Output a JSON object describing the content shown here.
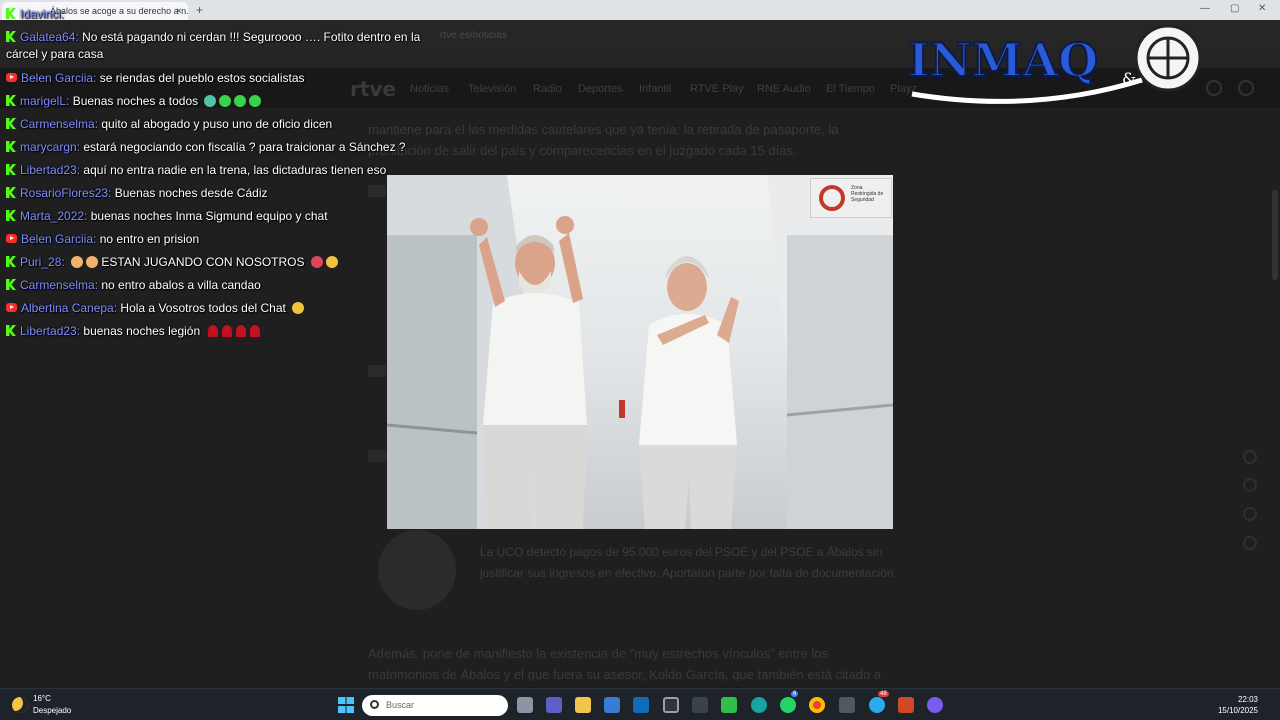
{
  "browser": {
    "tab_title": "Ábalos se acoge a su derecho a n...",
    "tab_close": "×",
    "new_tab": "+",
    "window_controls": [
      "—",
      "▢",
      "✕"
    ],
    "address": "rtve.es/noticias"
  },
  "site": {
    "logo": "rtve",
    "nav": [
      "Noticias",
      "Televisión",
      "Radio",
      "Deportes",
      "Infantil",
      "RTVE Play",
      "RNE Audio",
      "El Tiempo",
      "Playz"
    ]
  },
  "article": {
    "lines_top": [
      "mantiene para él las medidas cautelares que ya tenía: la retirada de pasaporte, la",
      "prohibición de salir del país y comparecencias en el juzgado cada 15 días."
    ],
    "quote": "La UCO detectó pagos de 95.000 euros del PSOE y del PSOE a Ábalos sin justificar sus ingresos en efectivo. Aportaron parte por falta de documentación",
    "lines_bottom": [
      "Además, pone de manifiesto la existencia de \"muy estrechos vínculos\" entre los",
      "matrimonios de Ábalos y el que fuera su asesor, Koldo García, que también está citado a"
    ],
    "photo_sign": "Zona Restringida de Seguridad"
  },
  "chat": {
    "messages": [
      {
        "platform": "kick",
        "user": "Idavinci:",
        "text": ""
      },
      {
        "platform": "kick",
        "user": "Galatea64:",
        "text": "No está pagando ni cerdan !!! Seguroooo …. Fotito dentro en la cárcel y para casa"
      },
      {
        "platform": "youtube",
        "user": "Belen Garciia:",
        "text": "se riendas del pueblo estos socialistas"
      },
      {
        "platform": "kick",
        "user": "marigelL:",
        "text": "Buenas noches a todos"
      },
      {
        "platform": "kick",
        "user": "Carmenselma:",
        "text": "quito al abogado y puso uno de oficio dicen"
      },
      {
        "platform": "kick",
        "user": "marycargn:",
        "text": "estará negociando con fiscalía ? para traicionar a Sánchez ?"
      },
      {
        "platform": "kick",
        "user": "Libertad23:",
        "text": "aquí no entra nadie en la trena, las dictaduras tienen eso"
      },
      {
        "platform": "kick",
        "user": "RosarioFlores23:",
        "text": "Buenas noches desde Cádiz"
      },
      {
        "platform": "kick",
        "user": "Marta_2022:",
        "text": "buenas noches Inma Sigmund equipo y chat"
      },
      {
        "platform": "youtube",
        "user": "Belen Garciia:",
        "text": "no entro en prision"
      },
      {
        "platform": "kick",
        "user": "Puri_28:",
        "text": "ESTAN JUGANDO CON NOSOTROS"
      },
      {
        "platform": "kick",
        "user": "Carmenselma:",
        "text": "no entro abalos a villa candao"
      },
      {
        "platform": "youtube",
        "user": "Albertina Canepa:",
        "text": "Hola a Vosotros todos del Chat"
      },
      {
        "platform": "kick",
        "user": "Libertad23:",
        "text": "buenas noches legión"
      }
    ]
  },
  "brand": {
    "name": "INMAQ",
    "amp": "&"
  },
  "taskbar": {
    "temperature": "16°C",
    "weather": "Despejado",
    "search_placeholder": "Buscar",
    "time": "22:03",
    "date": "15/10/2025",
    "badges": {
      "whatsapp": "6",
      "telegram": "48"
    },
    "colors": {
      "start": "#4cc2ff",
      "taskbar_bg": "#1e232a"
    }
  }
}
